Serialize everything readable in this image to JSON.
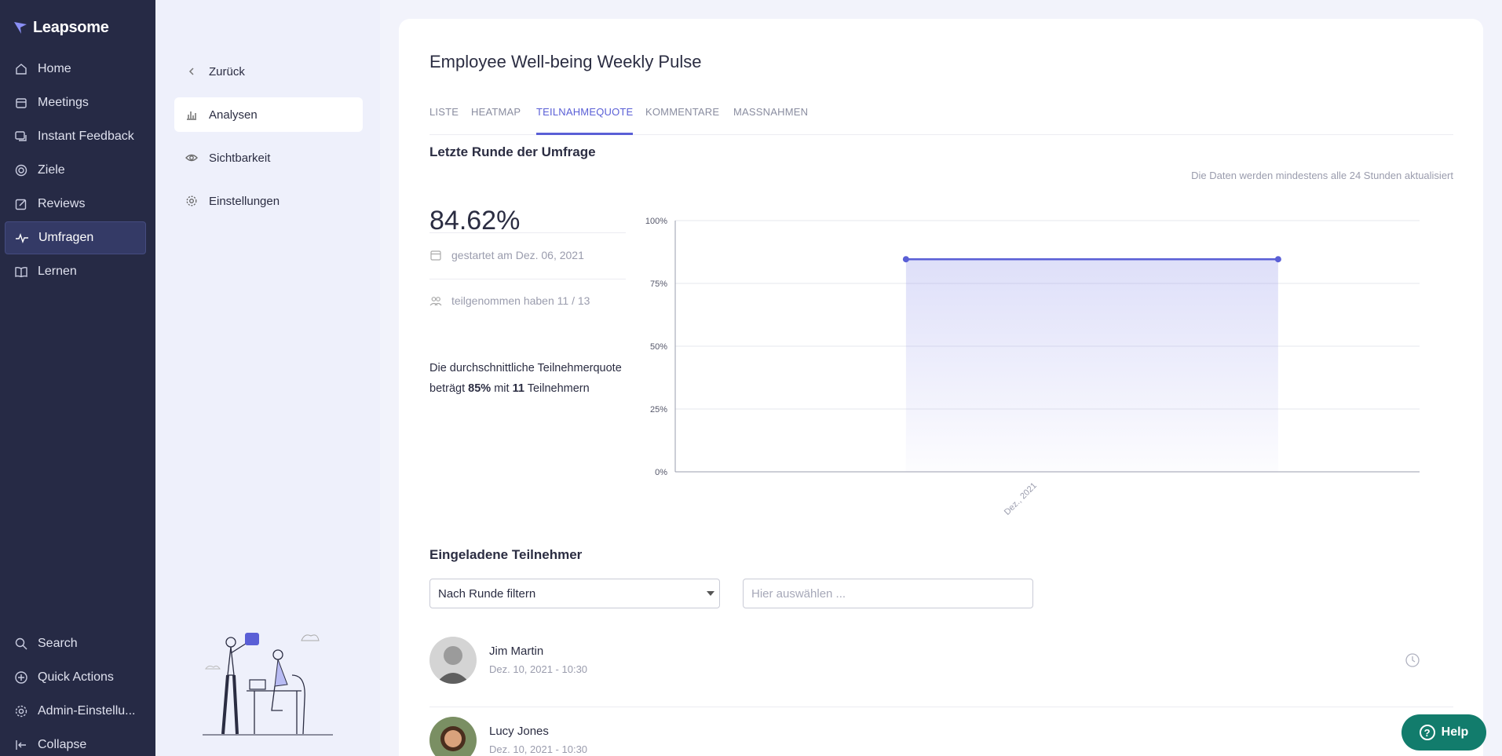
{
  "app": {
    "name": "Leapsome"
  },
  "nav": {
    "items": [
      {
        "label": "Home",
        "icon": "home-icon"
      },
      {
        "label": "Meetings",
        "icon": "calendar-icon"
      },
      {
        "label": "Instant Feedback",
        "icon": "chat-icon"
      },
      {
        "label": "Ziele",
        "icon": "target-icon"
      },
      {
        "label": "Reviews",
        "icon": "edit-icon"
      },
      {
        "label": "Umfragen",
        "icon": "pulse-icon",
        "active": true
      },
      {
        "label": "Lernen",
        "icon": "book-icon"
      }
    ],
    "bottom": [
      {
        "label": "Search",
        "icon": "search-icon"
      },
      {
        "label": "Quick Actions",
        "icon": "plus-circle-icon"
      },
      {
        "label": "Admin-Einstellu...",
        "icon": "gear-icon"
      },
      {
        "label": "Collapse",
        "icon": "collapse-icon"
      }
    ]
  },
  "subnav": {
    "back": "Zurück",
    "items": [
      {
        "label": "Analysen",
        "icon": "bar-chart-icon",
        "active": true
      },
      {
        "label": "Sichtbarkeit",
        "icon": "eye-icon"
      },
      {
        "label": "Einstellungen",
        "icon": "gear-icon"
      }
    ]
  },
  "page": {
    "title": "Employee Well-being Weekly Pulse",
    "tabs": [
      "LISTE",
      "HEATMAP",
      "TEILNAHMEQUOTE",
      "KOMMENTARE",
      "MASSNAHMEN"
    ],
    "active_tab": "TEILNAHMEQUOTE"
  },
  "summary": {
    "section_title": "Letzte Runde der Umfrage",
    "update_note": "Die Daten werden mindestens alle 24 Stunden aktualisiert",
    "percentage": "84.62%",
    "started": "gestartet am Dez. 06, 2021",
    "participated": "teilgenommen haben 11 / 13",
    "avg_prefix": "Die durchschnittliche Teilnehmerquote beträgt ",
    "avg_pct": "85%",
    "avg_mid": " mit ",
    "avg_count": "11",
    "avg_suffix": " Teilnehmern"
  },
  "chart_data": {
    "type": "area",
    "x": [
      "Dez., 2021"
    ],
    "series": [
      {
        "values": [
          84.62,
          84.62
        ]
      }
    ],
    "yticks": [
      "0%",
      "25%",
      "50%",
      "75%",
      "100%"
    ],
    "ylim": [
      0,
      100
    ],
    "grid": true,
    "accent": "#5a5fd6"
  },
  "participants": {
    "section_title": "Eingeladene Teilnehmer",
    "filter_select": "Nach Runde filtern",
    "filter_placeholder": "Hier auswählen ...",
    "rows": [
      {
        "name": "Jim Martin",
        "date": "Dez. 10, 2021 - 10:30"
      },
      {
        "name": "Lucy Jones",
        "date": "Dez. 10, 2021 - 10:30"
      }
    ]
  },
  "help": {
    "label": "Help"
  }
}
